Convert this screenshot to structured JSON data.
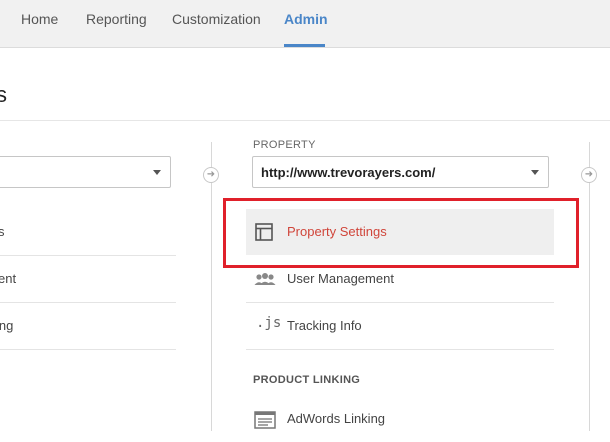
{
  "nav": {
    "tabs": [
      {
        "label": "Home"
      },
      {
        "label": "Reporting"
      },
      {
        "label": "Customization"
      },
      {
        "label": "Admin"
      }
    ]
  },
  "page": {
    "title_fragment": "s"
  },
  "left_column": {
    "items": [
      {
        "label": "s"
      },
      {
        "label": "ent"
      },
      {
        "label": "ing"
      }
    ]
  },
  "property": {
    "section_label": "PROPERTY",
    "selected": "http://www.trevorayers.com/",
    "items": [
      {
        "label": "Property Settings",
        "icon": "property-settings-icon"
      },
      {
        "label": "User Management",
        "icon": "users-icon"
      },
      {
        "label": "Tracking Info",
        "icon": "js-icon",
        "icon_text": ".js"
      }
    ],
    "product_linking_label": "PRODUCT LINKING",
    "linking_items": [
      {
        "label": "AdWords Linking",
        "icon": "adwords-icon"
      }
    ]
  },
  "colors": {
    "accent": "#4a86c8",
    "selected_text": "#d0453a",
    "highlight": "#e0202a"
  }
}
